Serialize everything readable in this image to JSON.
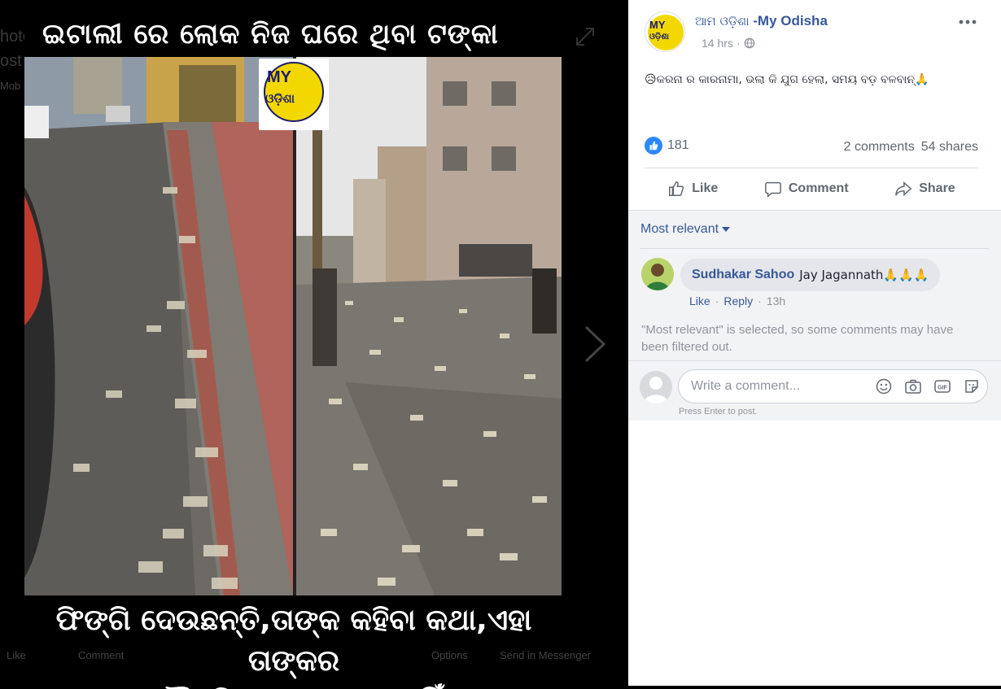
{
  "viewer": {
    "ghost_text": [
      "hotos",
      "ost",
      "Mob"
    ],
    "ghost_bottom": [
      "Like",
      "Comment",
      "Options",
      "Send in Messenger"
    ],
    "image": {
      "headline": "ଇଟାଲୀ ରେ ଲୋକ ନିଜ ଘରେ ଥିବା  ଟଙ୍କା",
      "caption_line1": "ଫିଙ୍ଗି ଦେଉଛନ୍ତି,ତାଙ୍କ କହିବା କଥା,ଏହା ତାଙ୍କର",
      "caption_line2": "କୌଣସି କାମ ରେ  ଲାଗୁନାହିଁ",
      "logo_my": "MY",
      "logo_odisha": "ଓଡ଼ିଶା"
    }
  },
  "post": {
    "page_name_odia": "ଆମ ଓଡ଼ିଶା",
    "page_name_en": " -My Odisha",
    "time": "14 hrs",
    "time_sep": "·",
    "avatar_my": "MY",
    "avatar_odisha": "ଓଡ଼ିଶା",
    "text": "😥କରନା ର କାରନାମା, ଭଲା କି ଯୁଗ ହେଲା, ସମୟ ବଡ଼ ବଳବାନ୍🙏",
    "like_count": "181",
    "comments_count": "2 comments",
    "shares_count": "54 shares",
    "actions": {
      "like": "Like",
      "comment": "Comment",
      "share": "Share"
    }
  },
  "comments": {
    "sort_label": "Most relevant",
    "items": [
      {
        "name": "Sudhakar Sahoo",
        "text": "Jay Jagannath🙏🙏🙏",
        "like": "Like",
        "reply": "Reply",
        "time": "13h",
        "sep": "·"
      }
    ],
    "filter_note": "\"Most relevant\" is selected, so some comments may have been filtered out.",
    "write_placeholder": "Write a comment...",
    "press_enter": "Press Enter to post."
  },
  "colors": {
    "link": "#385898",
    "meta": "#90949c",
    "like_blue": "#2d88ff",
    "panel_bg": "#f2f3f5"
  }
}
